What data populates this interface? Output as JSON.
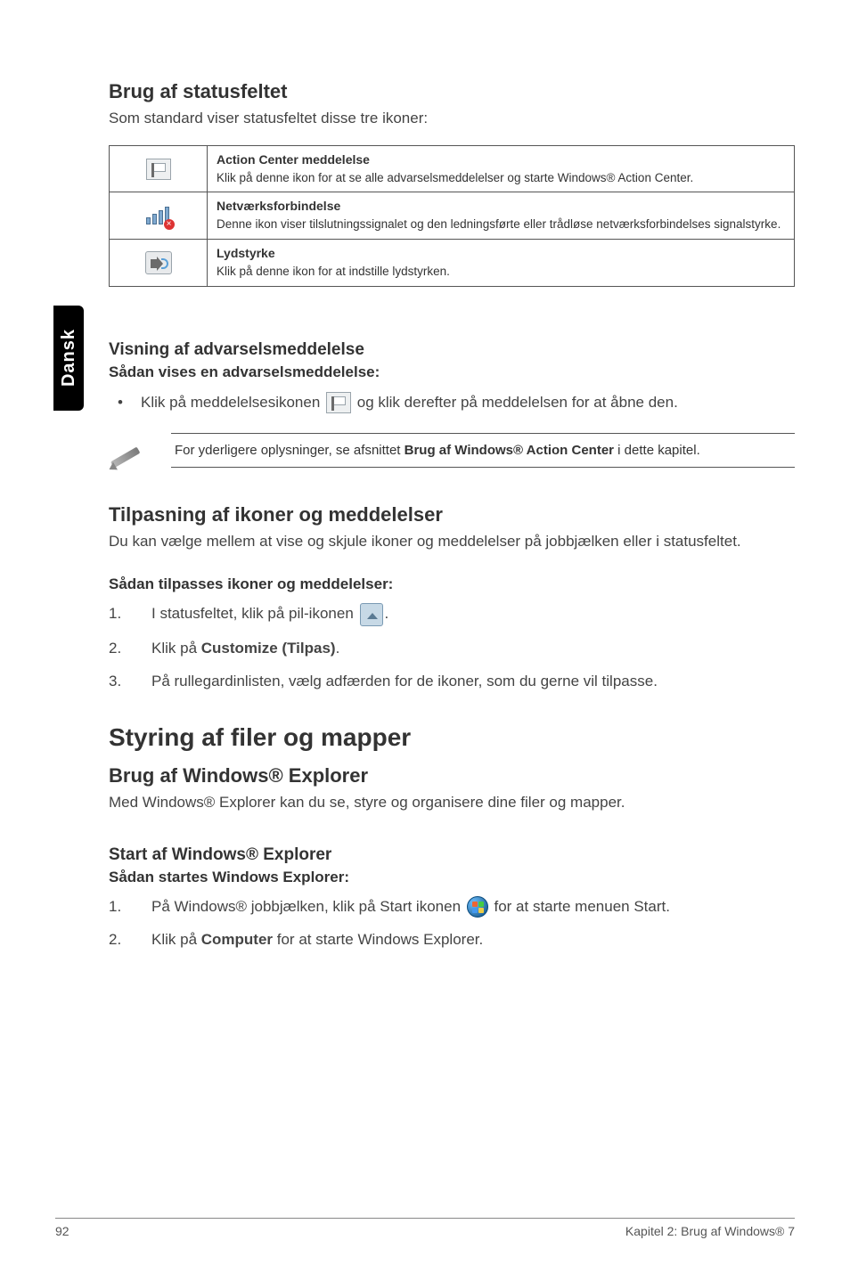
{
  "side_tab": "Dansk",
  "h_statusfeltet": "Brug af statusfeltet",
  "p_statusfeltet": "Som standard viser statusfeltet disse tre ikoner:",
  "table": {
    "rows": [
      {
        "title": "Action Center meddelelse",
        "desc": "Klik på denne ikon for at se alle advarselsmeddelelser og starte Windows® Action Center."
      },
      {
        "title": "Netværksforbindelse",
        "desc": "Denne ikon viser tilslutningssignalet og den ledningsførte eller trådløse netværksforbindelses signalstyrke."
      },
      {
        "title": "Lydstyrke",
        "desc": "Klik på denne ikon for at indstille lydstyrken."
      }
    ]
  },
  "h_visning": "Visning af advarselsmeddelelse",
  "h_visning_sub": "Sådan vises en advarselsmeddelelse:",
  "bullet_part1": "Klik på meddelelsesikonen ",
  "bullet_part2": " og klik derefter på meddelelsen for at åbne den.",
  "note_part1": "For yderligere oplysninger, se afsnittet ",
  "note_bold": "Brug af Windows® Action Center",
  "note_part2": " i dette kapitel.",
  "h_tilpasning": "Tilpasning af ikoner og meddelelser",
  "p_tilpasning": "Du kan vælge mellem at vise og skjule ikoner og meddelelser på jobbjælken eller i statusfeltet.",
  "h_tilpasses": "Sådan tilpasses ikoner og meddelelser:",
  "steps_tilpas": {
    "s1a": "I statusfeltet, klik på pil-ikonen ",
    "s1b": ".",
    "s2a": "Klik på ",
    "s2b": "Customize (Tilpas)",
    "s2c": ".",
    "s3": "På rullegardinlisten, vælg adfærden for de ikoner, som du gerne vil tilpasse."
  },
  "h_styring": "Styring af filer og mapper",
  "h_explorer": "Brug af Windows® Explorer",
  "p_explorer": "Med Windows® Explorer kan du se, styre og organisere dine filer og mapper.",
  "h_start": "Start af Windows® Explorer",
  "h_start_sub": "Sådan startes Windows Explorer:",
  "steps_start": {
    "s1a": "På Windows® jobbjælken, klik på Start ikonen ",
    "s1b": " for at starte menuen Start.",
    "s2a": "Klik på ",
    "s2b": "Computer",
    "s2c": " for at starte Windows Explorer."
  },
  "footer": {
    "left": "92",
    "right": "Kapitel 2: Brug af Windows® 7"
  }
}
